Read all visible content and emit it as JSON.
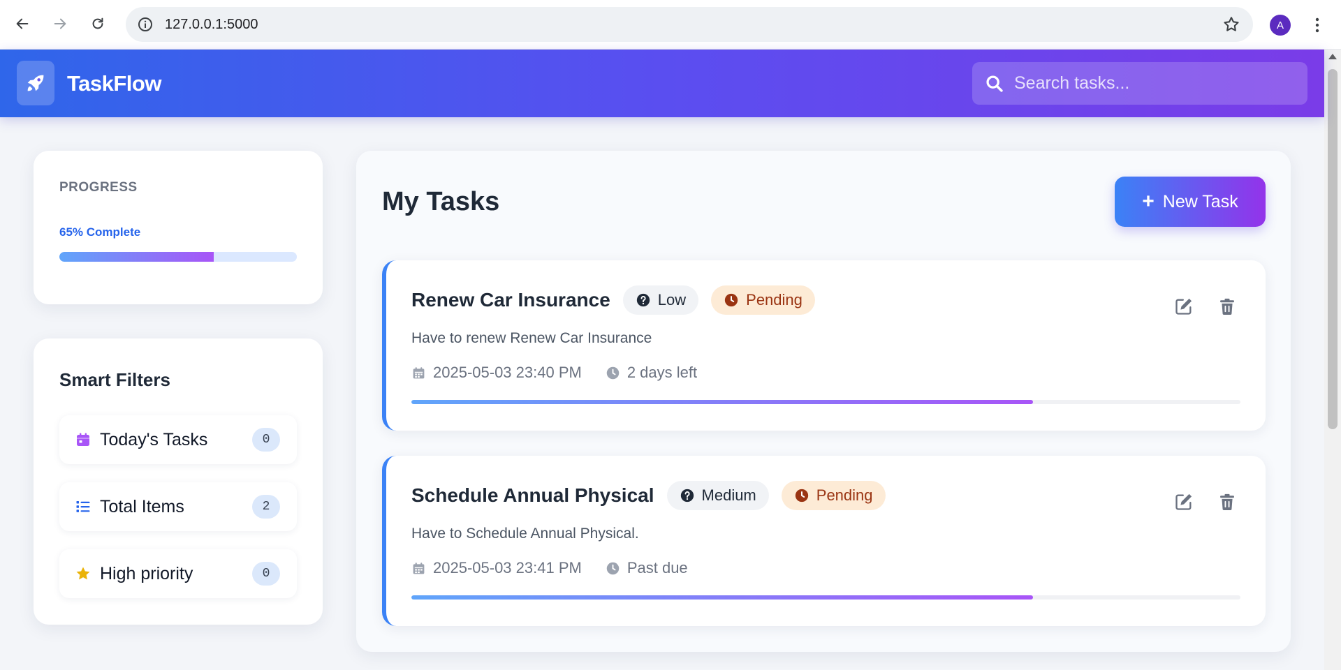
{
  "browser": {
    "url": "127.0.0.1:5000",
    "avatar_letter": "A"
  },
  "header": {
    "brand": "TaskFlow",
    "search_placeholder": "Search tasks...",
    "gradient": [
      "#2f66ea",
      "#7a3ce8"
    ]
  },
  "progress": {
    "title": "PROGRESS",
    "label": "65% Complete",
    "percent": 65
  },
  "filters": {
    "title": "Smart Filters",
    "items": [
      {
        "label": "Today's Tasks",
        "count": "0",
        "icon": "calendar-icon",
        "color": "#a855f7"
      },
      {
        "label": "Total Items",
        "count": "2",
        "icon": "list-icon",
        "color": "#2563eb"
      },
      {
        "label": "High priority",
        "count": "0",
        "icon": "star-icon",
        "color": "#eab308"
      }
    ]
  },
  "main": {
    "title": "My Tasks",
    "new_button": "New Task",
    "tasks": [
      {
        "title": "Renew Car Insurance",
        "priority": "Low",
        "status": "Pending",
        "description": "Have to renew Renew Car Insurance",
        "date": "2025-05-03 23:40 PM",
        "due": "2 days left",
        "progress": 75
      },
      {
        "title": "Schedule Annual Physical",
        "priority": "Medium",
        "status": "Pending",
        "description": "Have to Schedule Annual Physical.",
        "date": "2025-05-03 23:41 PM",
        "due": "Past due",
        "progress": 75
      }
    ]
  }
}
